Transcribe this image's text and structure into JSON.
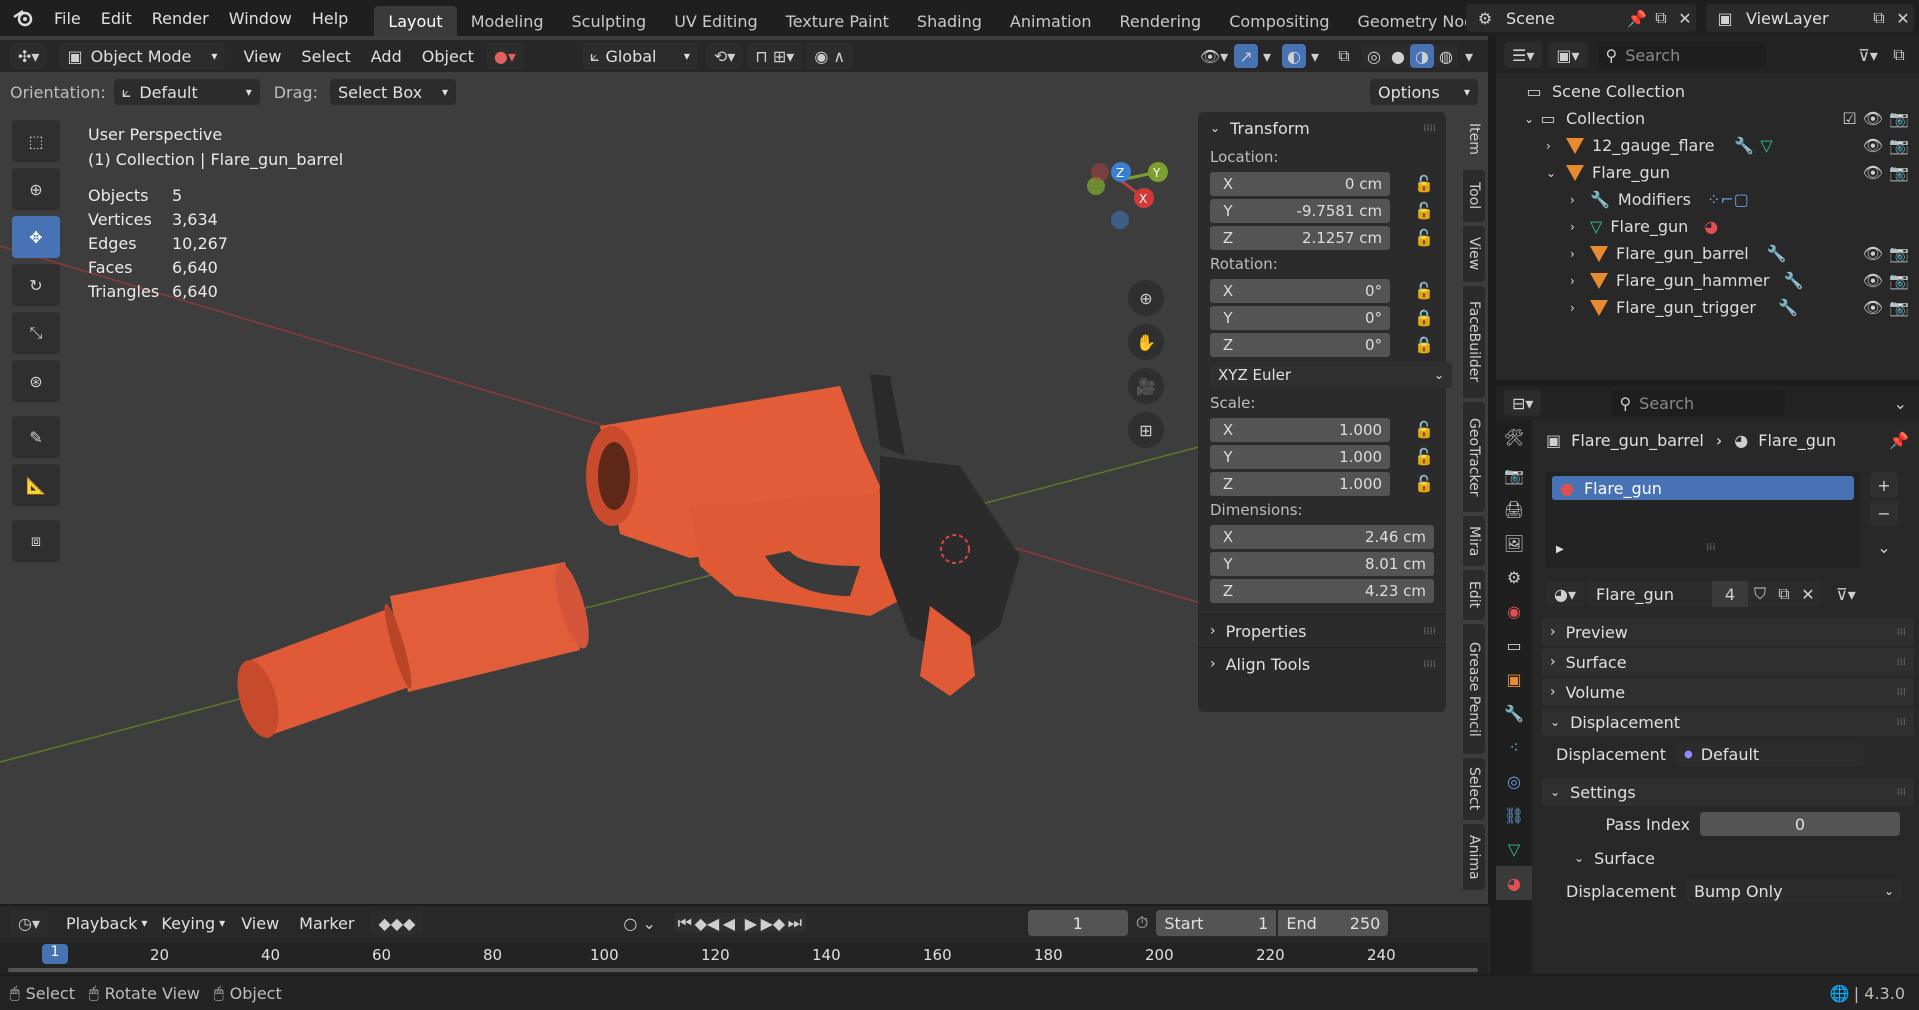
{
  "menus": [
    "File",
    "Edit",
    "Render",
    "Window",
    "Help"
  ],
  "workspaces": [
    "Layout",
    "Modeling",
    "Sculpting",
    "UV Editing",
    "Texture Paint",
    "Shading",
    "Animation",
    "Rendering",
    "Compositing",
    "Geometry Nodes"
  ],
  "scene": {
    "label": "Scene",
    "viewlayer": "ViewLayer"
  },
  "header": {
    "mode": "Object Mode",
    "menus": [
      "View",
      "Select",
      "Add",
      "Object"
    ],
    "transform": "Global"
  },
  "toolopts": {
    "orientation_label": "Orientation:",
    "orientation_value": "Default",
    "drag_label": "Drag:",
    "drag_value": "Select Box",
    "options": "Options"
  },
  "viewport": {
    "perspective": "User Perspective",
    "context": "(1) Collection | Flare_gun_barrel",
    "stats": [
      {
        "k": "Objects",
        "v": "5"
      },
      {
        "k": "Vertices",
        "v": "3,634"
      },
      {
        "k": "Edges",
        "v": "10,267"
      },
      {
        "k": "Faces",
        "v": "6,640"
      },
      {
        "k": "Triangles",
        "v": "6,640"
      }
    ],
    "gizmo": {
      "z": "Z",
      "y": "Y",
      "x": "X"
    }
  },
  "npanel": {
    "transform": "Transform",
    "location": "Location:",
    "loc": [
      {
        "a": "X",
        "v": "0 cm"
      },
      {
        "a": "Y",
        "v": "-9.7581 cm"
      },
      {
        "a": "Z",
        "v": "2.1257 cm"
      }
    ],
    "rotation": "Rotation:",
    "rot": [
      {
        "a": "X",
        "v": "0°"
      },
      {
        "a": "Y",
        "v": "0°"
      },
      {
        "a": "Z",
        "v": "0°"
      }
    ],
    "rotmode": "XYZ Euler",
    "scale": "Scale:",
    "scl": [
      {
        "a": "X",
        "v": "1.000"
      },
      {
        "a": "Y",
        "v": "1.000"
      },
      {
        "a": "Z",
        "v": "1.000"
      }
    ],
    "dimensions": "Dimensions:",
    "dim": [
      {
        "a": "X",
        "v": "2.46 cm"
      },
      {
        "a": "Y",
        "v": "8.01 cm"
      },
      {
        "a": "Z",
        "v": "4.23 cm"
      }
    ],
    "properties": "Properties",
    "align": "Align Tools"
  },
  "sidetabs": [
    "Item",
    "Tool",
    "View",
    "FaceBuilder",
    "GeoTracker",
    "Mira",
    "Edit",
    "Grease Pencil",
    "Select",
    "Anima"
  ],
  "outliner": {
    "search": "Search",
    "scene_collection": "Scene Collection",
    "collection": "Collection",
    "items": [
      "12_gauge_flare",
      "Flare_gun",
      "Modifiers",
      "Flare_gun",
      "Flare_gun_barrel",
      "Flare_gun_hammer",
      "Flare_gun_trigger"
    ]
  },
  "props": {
    "search": "Search",
    "crumb_obj": "Flare_gun_barrel",
    "crumb_mat": "Flare_gun",
    "slot": "Flare_gun",
    "matname": "Flare_gun",
    "users": "4",
    "sections": [
      "Preview",
      "Surface",
      "Volume",
      "Displacement"
    ],
    "disp_label": "Displacement",
    "disp_value": "Default",
    "settings": "Settings",
    "pass_label": "Pass Index",
    "pass_value": "0",
    "surface": "Surface",
    "disp2_label": "Displacement",
    "disp2_value": "Bump Only"
  },
  "timeline": {
    "menus": [
      "Playback",
      "Keying",
      "View",
      "Marker"
    ],
    "frame": "1",
    "start_label": "Start",
    "start": "1",
    "end_label": "End",
    "end": "250",
    "ruler": [
      "1",
      "20",
      "40",
      "60",
      "80",
      "100",
      "120",
      "140",
      "160",
      "180",
      "200",
      "220",
      "240"
    ]
  },
  "status": {
    "select": "Select",
    "rotate": "Rotate View",
    "object": "Object",
    "version": "4.3.0"
  },
  "colors": {
    "accent": "#4772b3",
    "orange": "#e66a3a",
    "bg": "#1d1d1d",
    "panel": "#303030"
  }
}
